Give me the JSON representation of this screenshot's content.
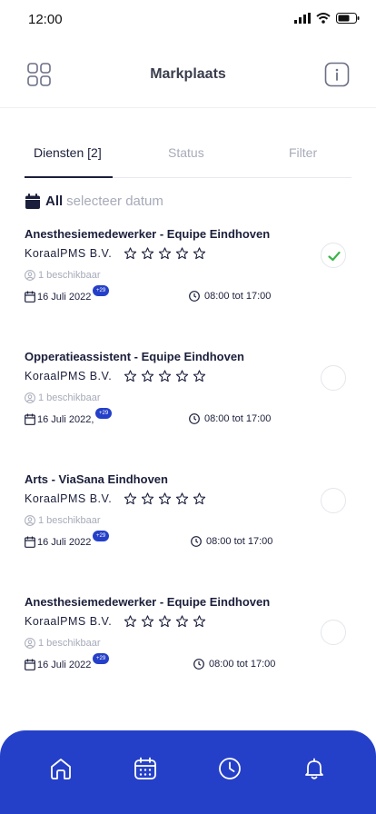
{
  "status_bar": {
    "time": "12:00"
  },
  "header": {
    "title": "Markplaats"
  },
  "tabs": [
    {
      "label": "Diensten [2]",
      "active": true
    },
    {
      "label": "Status",
      "active": false
    },
    {
      "label": "Filter",
      "active": false
    }
  ],
  "date_filter": {
    "all_label": "All",
    "pick_label": "selecteer datum"
  },
  "shifts": [
    {
      "title": "Anesthesiemedewerker - Equipe Eindhoven",
      "company": "KoraalPMS B.V.",
      "rating": 0,
      "rating_max": 5,
      "availability": "1 beschikbaar",
      "date": "16 Juli 2022",
      "extra_badge": "+29",
      "time": "08:00 tot 17:00",
      "selected": true
    },
    {
      "title": "Opperatieassistent - Equipe Eindhoven",
      "company": "KoraalPMS B.V.",
      "rating": 0,
      "rating_max": 5,
      "availability": "1 beschikbaar",
      "date": "16 Juli 2022,",
      "extra_badge": "+29",
      "time": "08:00 tot 17:00",
      "selected": false
    },
    {
      "title": "Arts - ViaSana Eindhoven",
      "company": "KoraalPMS B.V.",
      "rating": 0,
      "rating_max": 5,
      "availability": "1 beschikbaar",
      "date": "16 Juli 2022",
      "extra_badge": "+29",
      "time": "08:00 tot 17:00",
      "selected": false
    },
    {
      "title": "Anesthesiemedewerker - Equipe Eindhoven",
      "company": "KoraalPMS B.V.",
      "rating": 0,
      "rating_max": 5,
      "availability": "1 beschikbaar",
      "date": "16 Juli 2022",
      "extra_badge": "+29",
      "time": "08:00 tot 17:00",
      "selected": false
    }
  ],
  "bottom_nav": [
    {
      "icon": "home-icon"
    },
    {
      "icon": "calendar-icon"
    },
    {
      "icon": "clock-icon"
    },
    {
      "icon": "bell-icon"
    }
  ],
  "colors": {
    "accent": "#2540c8",
    "text": "#1b1f3b",
    "muted": "#a7abb9",
    "check": "#3bb54a"
  }
}
